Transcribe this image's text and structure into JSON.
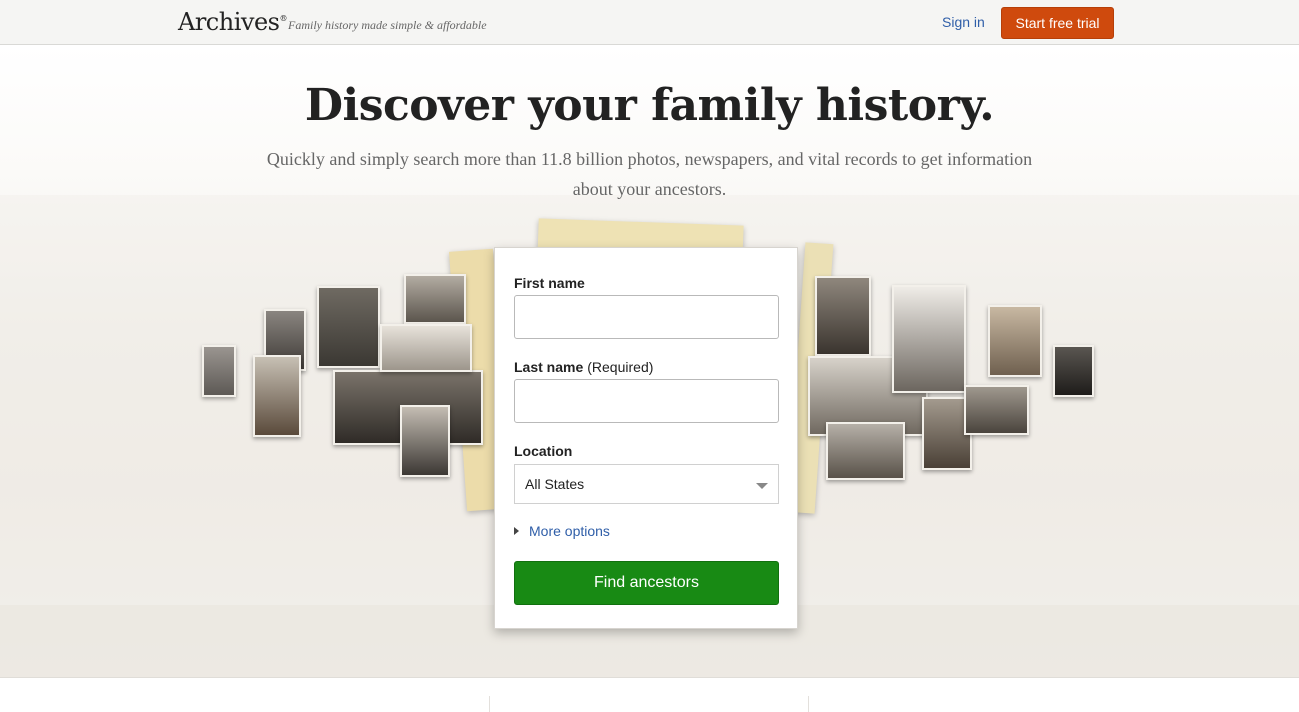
{
  "header": {
    "logo_text": "Archives",
    "logo_mark": "®",
    "tagline": "Family history made simple & affordable",
    "signin_label": "Sign in",
    "trial_label": "Start free trial"
  },
  "hero": {
    "headline": "Discover your family history.",
    "subhead": "Quickly and simply search more than 11.8 billion photos, newspapers, and vital records to get information about your ancestors."
  },
  "form": {
    "first_name_label": "First name",
    "first_name_value": "",
    "last_name_label": "Last name",
    "last_name_required": "(Required)",
    "last_name_value": "",
    "location_label": "Location",
    "location_value": "All States",
    "more_options_label": "More options",
    "find_label": "Find ancestors"
  },
  "icons": {
    "select_caret": "chevron-down-icon",
    "more_caret": "caret-right-icon"
  },
  "colors": {
    "trial_button": "#cf4a0d",
    "find_button": "#188a14",
    "link": "#2f5ea8"
  }
}
